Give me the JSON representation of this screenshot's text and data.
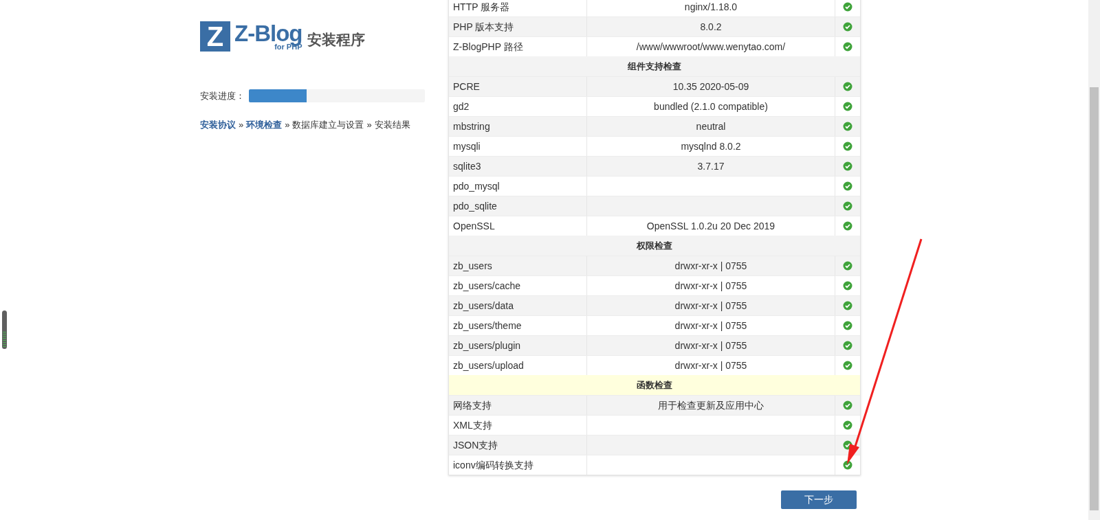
{
  "logo": {
    "letter": "Z",
    "name": "Z-Blog",
    "sub": "for PHP",
    "title": "安装程序"
  },
  "progress": {
    "label": "安装进度：",
    "level": 0.33
  },
  "steps": [
    {
      "label": "安装协议",
      "done": true
    },
    {
      "label": "环境检查",
      "done": true
    },
    {
      "label": "数据库建立与设置",
      "done": false
    },
    {
      "label": "安装结果",
      "done": false
    }
  ],
  "step_separator": "»",
  "table": {
    "rows": [
      {
        "kind": "item",
        "name": "HTTP 服务器",
        "value": "nginx/1.18.0",
        "ok": true
      },
      {
        "kind": "item",
        "name": "PHP 版本支持",
        "value": "8.0.2",
        "ok": true
      },
      {
        "kind": "item",
        "name": "Z-BlogPHP 路径",
        "value": "/www/wwwroot/www.wenytao.com/",
        "ok": true
      },
      {
        "kind": "section",
        "name": "组件支持检查",
        "highlighted": false
      },
      {
        "kind": "item",
        "name": "PCRE",
        "value": "10.35 2020-05-09",
        "ok": true
      },
      {
        "kind": "item",
        "name": "gd2",
        "value": "bundled (2.1.0 compatible)",
        "ok": true
      },
      {
        "kind": "item",
        "name": "mbstring",
        "value": "neutral",
        "ok": true
      },
      {
        "kind": "item",
        "name": "mysqli",
        "value": "mysqlnd 8.0.2",
        "ok": true
      },
      {
        "kind": "item",
        "name": "sqlite3",
        "value": "3.7.17",
        "ok": true
      },
      {
        "kind": "item",
        "name": "pdo_mysql",
        "ok": true
      },
      {
        "kind": "item",
        "name": "pdo_sqlite",
        "ok": true
      },
      {
        "kind": "item",
        "name": "OpenSSL",
        "value": "OpenSSL 1.0.2u 20 Dec 2019",
        "ok": true
      },
      {
        "kind": "section",
        "name": "权限检查",
        "highlighted": false
      },
      {
        "kind": "item",
        "name": "zb_users",
        "value": "drwxr-xr-x | 0755",
        "ok": true
      },
      {
        "kind": "item",
        "name": "zb_users/cache",
        "value": "drwxr-xr-x | 0755",
        "ok": true
      },
      {
        "kind": "item",
        "name": "zb_users/data",
        "value": "drwxr-xr-x | 0755",
        "ok": true
      },
      {
        "kind": "item",
        "name": "zb_users/theme",
        "value": "drwxr-xr-x | 0755",
        "ok": true
      },
      {
        "kind": "item",
        "name": "zb_users/plugin",
        "value": "drwxr-xr-x | 0755",
        "ok": true
      },
      {
        "kind": "item",
        "name": "zb_users/upload",
        "value": "drwxr-xr-x | 0755",
        "ok": true
      },
      {
        "kind": "section",
        "name": "函数检查",
        "highlighted": true
      },
      {
        "kind": "item",
        "name": "网络支持",
        "value": "用于检查更新及应用中心",
        "ok": true
      },
      {
        "kind": "item",
        "name": "XML支持",
        "ok": true
      },
      {
        "kind": "item",
        "name": "JSON支持",
        "ok": true
      },
      {
        "kind": "item",
        "name": "iconv编码转换支持",
        "ok": true
      }
    ]
  },
  "next_button": "下一步"
}
